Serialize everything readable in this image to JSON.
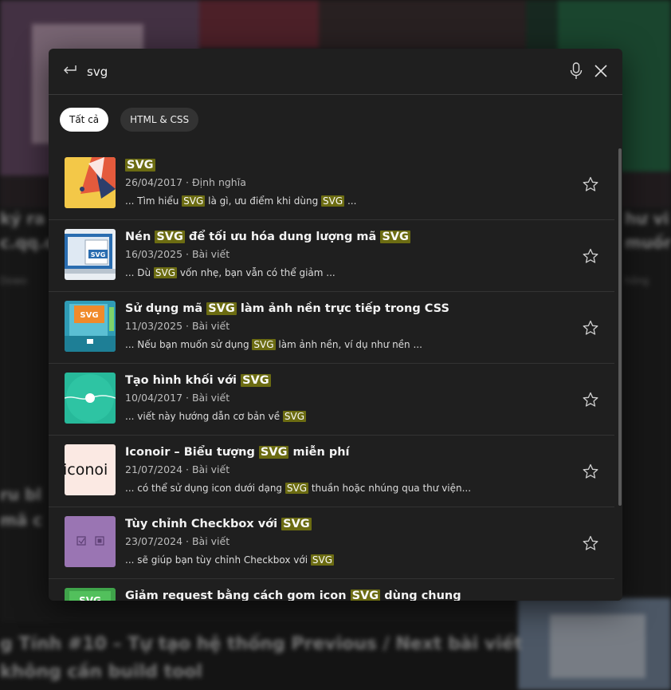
{
  "search": {
    "query": "svg",
    "placeholder": ""
  },
  "filters": [
    {
      "label": "Tất cả",
      "active": true
    },
    {
      "label": "HTML & CSS",
      "active": false
    }
  ],
  "results": [
    {
      "title_parts": [
        "",
        "SVG",
        ""
      ],
      "date": "26/04/2017",
      "type": "Định nghĩa",
      "snippet_parts": [
        "... Tìm hiểu ",
        "SVG",
        " là gì, ưu điểm khi dùng ",
        "SVG",
        " ..."
      ],
      "thumb": "red-geometric-thumb"
    },
    {
      "title_parts": [
        "Nén ",
        "SVG",
        " để tối ưu hóa dung lượng mã ",
        "SVG",
        ""
      ],
      "date": "16/03/2025",
      "type": "Bài viết",
      "snippet_parts": [
        "... Dù ",
        "SVG",
        " vốn nhẹ, bạn vẫn có thể giảm ..."
      ],
      "thumb": "svg-file-laptop-thumb"
    },
    {
      "title_parts": [
        "Sử dụng mã ",
        "SVG",
        " làm ảnh nền trực tiếp trong CSS"
      ],
      "date": "11/03/2025",
      "type": "Bài viết",
      "snippet_parts": [
        "... Nếu bạn muốn sử dụng ",
        "SVG",
        " làm ảnh nền, ví dụ như nền ..."
      ],
      "thumb": "svg-background-thumb"
    },
    {
      "title_parts": [
        "Tạo hình khối với ",
        "SVG",
        ""
      ],
      "date": "10/04/2017",
      "type": "Bài viết",
      "snippet_parts": [
        "... viết này hướng dẫn cơ bản về ",
        "SVG",
        ""
      ],
      "thumb": "teal-shape-thumb"
    },
    {
      "title_parts": [
        "Iconoir – Biểu tượng ",
        "SVG",
        " miễn phí"
      ],
      "date": "21/07/2024",
      "type": "Bài viết",
      "snippet_parts": [
        "... có thể sử dụng icon dưới dạng ",
        "SVG",
        " thuần hoặc nhúng qua thư viện..."
      ],
      "thumb": "iconoir-logo-thumb",
      "thumb_text": "iconoi"
    },
    {
      "title_parts": [
        "Tùy chỉnh Checkbox với ",
        "SVG",
        ""
      ],
      "date": "23/07/2024",
      "type": "Bài viết",
      "snippet_parts": [
        "... sẽ giúp bạn tùy chỉnh Checkbox với ",
        "SVG",
        ""
      ],
      "thumb": "purple-checkbox-thumb"
    },
    {
      "title_parts": [
        "Giảm request bằng cách gom icon ",
        "SVG",
        " dùng chung"
      ],
      "date": "",
      "type": "",
      "snippet_parts": [
        ""
      ],
      "thumb": "green-svg-thumb"
    }
  ],
  "meta_separator": " · ",
  "thumb_labels": {
    "svg": "SVG"
  },
  "icons": [
    "back-arrow-icon",
    "microphone-icon",
    "close-icon",
    "star-icon"
  ],
  "colors": {
    "modal_bg": "#1f1f1f",
    "highlight": "#6c6c12",
    "chip_active": "#ffffff",
    "chip_inactive": "#333333"
  }
}
